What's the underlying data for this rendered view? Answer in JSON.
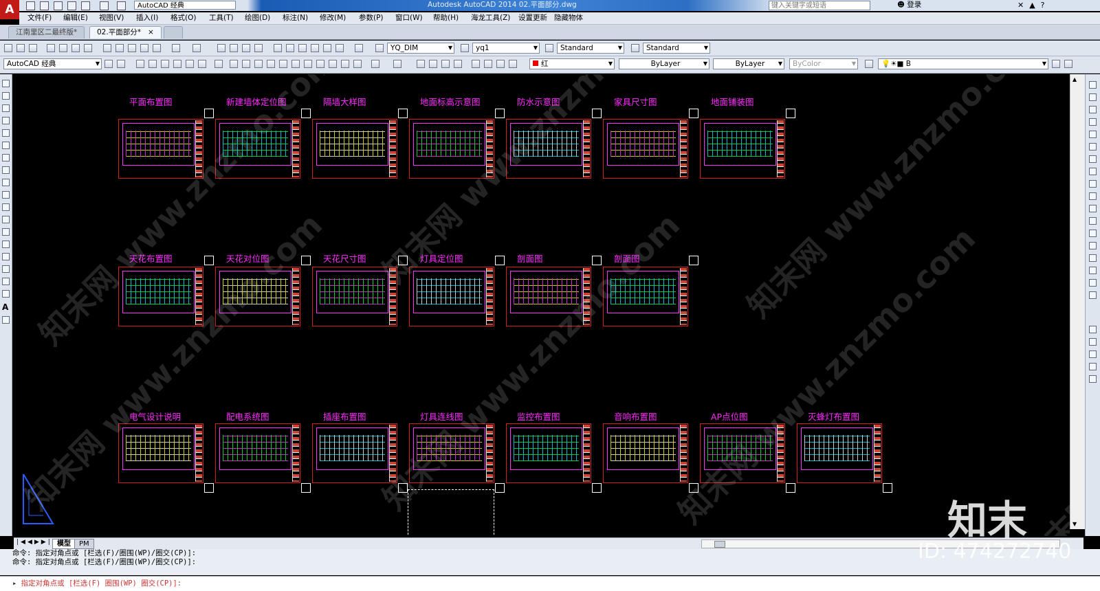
{
  "title_bar": {
    "workspace": "AutoCAD 经典",
    "title": "Autodesk AutoCAD 2014      02.平面部分.dwg",
    "search_placeholder": "键入关键字或短语",
    "login": "登录"
  },
  "menu": [
    "文件(F)",
    "编辑(E)",
    "视图(V)",
    "插入(I)",
    "格式(O)",
    "工具(T)",
    "绘图(D)",
    "标注(N)",
    "修改(M)",
    "参数(P)",
    "窗口(W)",
    "帮助(H)",
    "海龙工具(Z)",
    "设置更新",
    "隐藏物体"
  ],
  "tabs": [
    {
      "label": "江南里区二最终版*",
      "active": false
    },
    {
      "label": "02.平面部分*",
      "active": true
    }
  ],
  "toolbar1": {
    "dimstyle": "YQ_DIM",
    "multileader": "yq1",
    "textstyle": "Standard",
    "tablestyle": "Standard"
  },
  "toolbar2": {
    "workspace": "AutoCAD 经典",
    "color": "红",
    "linetype": "ByLayer",
    "lineweight": "ByLayer",
    "plotstyle": "ByColor",
    "layer": "B"
  },
  "colors": {
    "sheet_border": "#d21e1e",
    "title_text": "#ff2bff",
    "accent": "#c21b17"
  },
  "sheets_row1": [
    "平面布置图",
    "新建墙体定位图",
    "隔墙大样图",
    "地面标高示意图",
    "防水示意图",
    "家具尺寸图",
    "地面铺装图"
  ],
  "sheets_row2": [
    "天花布置图",
    "天花对位图",
    "天花尺寸图",
    "灯具定位图",
    "剖面图",
    "剖面图"
  ],
  "sheets_row3": [
    "电气设计说明",
    "配电系统图",
    "插座布置图",
    "灯具连线图",
    "监控布置图",
    "音响布置图",
    "AP点位图",
    "灭蜂灯布置图"
  ],
  "layout_tabs": [
    "模型",
    "PM"
  ],
  "command": {
    "history": [
      "命令: 指定对角点或 [栏选(F)/圈围(WP)/圈交(CP)]:",
      "命令: 指定对角点或 [栏选(F)/圈围(WP)/圈交(CP)]:"
    ],
    "prompt": "指定对角点或 [栏选(F) 圈围(WP) 圈交(CP)]:"
  },
  "watermarks": {
    "brand": "知末",
    "id": "ID: 474272740",
    "site": "知末网 www.znzmo.com"
  }
}
